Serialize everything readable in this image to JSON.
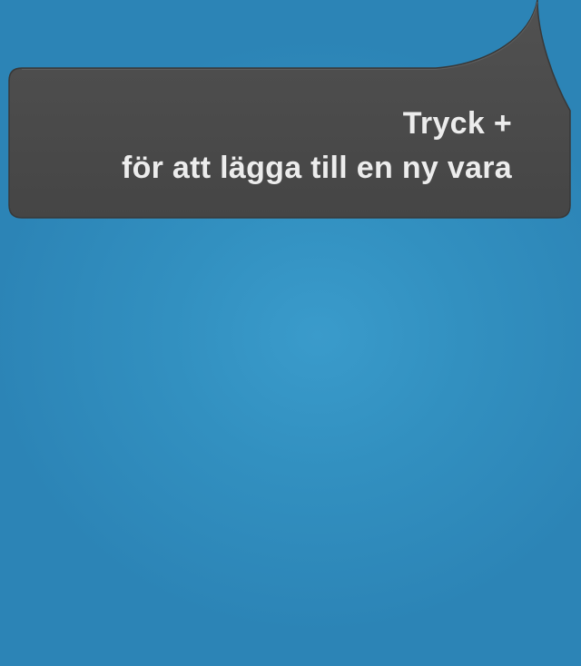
{
  "hint": {
    "line1": "Tryck +",
    "line2": "för att lägga till en ny vara"
  },
  "colors": {
    "background": "#3290c0",
    "bubble": "#4a4a4a",
    "text": "#ececec"
  }
}
